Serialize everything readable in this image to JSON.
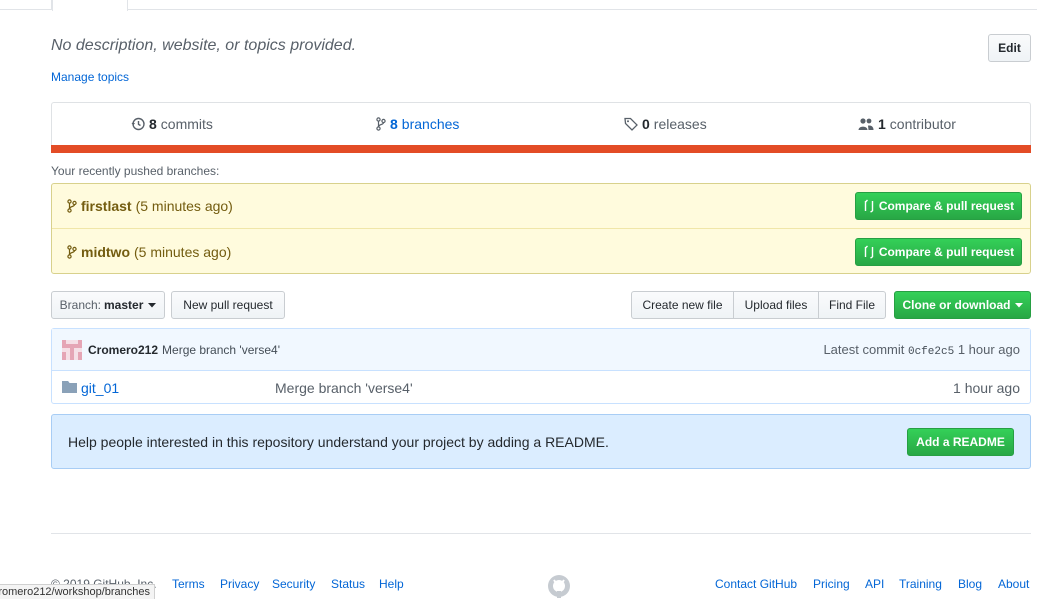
{
  "repo": {
    "description": "No description, website, or topics provided.",
    "edit_label": "Edit",
    "manage_topics": "Manage topics"
  },
  "summary": {
    "commits_count": "8",
    "commits_label": "commits",
    "branches_count": "8",
    "branches_label": "branches",
    "releases_count": "0",
    "releases_label": "releases",
    "contributors_count": "1",
    "contributors_label": "contributor",
    "language_color": "#e34c26"
  },
  "recent": {
    "title": "Your recently pushed branches:",
    "branches": [
      {
        "name": "firstlast",
        "time": "(5 minutes ago)",
        "button": "Compare & pull request"
      },
      {
        "name": "midtwo",
        "time": "(5 minutes ago)",
        "button": "Compare & pull request"
      }
    ]
  },
  "toolbar": {
    "branch_prefix": "Branch:",
    "branch_name": "master",
    "new_pr": "New pull request",
    "create_file": "Create new file",
    "upload_files": "Upload files",
    "find_file": "Find File",
    "clone": "Clone or download"
  },
  "commit": {
    "author": "Cromero212",
    "message": "Merge branch 'verse4'",
    "latest_label": "Latest commit",
    "sha": "0cfe2c5",
    "age": "1 hour ago"
  },
  "files": [
    {
      "name": "git_01",
      "message": "Merge branch 'verse4'",
      "age": "1 hour ago"
    }
  ],
  "readme": {
    "text": "Help people interested in this repository understand your project by adding a README.",
    "button": "Add a README"
  },
  "footer": {
    "copyright": "© 2019 GitHub, Inc.",
    "left_links": [
      "Terms",
      "Privacy",
      "Security",
      "Status",
      "Help"
    ],
    "right_links": [
      "Contact GitHub",
      "Pricing",
      "API",
      "Training",
      "Blog",
      "About"
    ]
  },
  "status_url": "github.com/Cromero212/workshop/branches"
}
